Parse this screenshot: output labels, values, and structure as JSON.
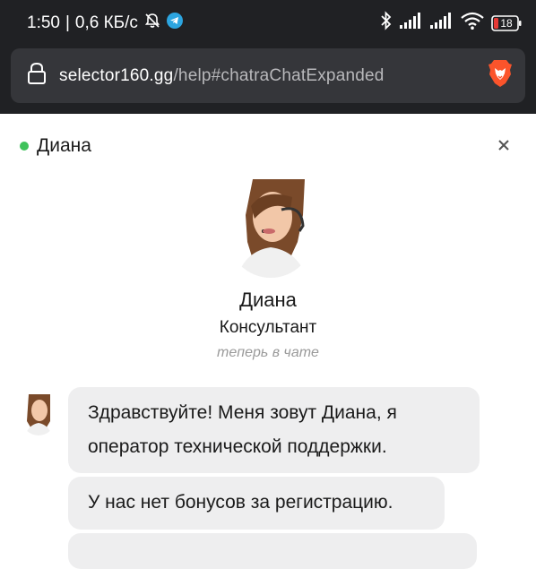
{
  "status_bar": {
    "time": "1:50",
    "speed": "0,6 КБ/с",
    "battery": "18",
    "icons": [
      "bell-off-icon",
      "telegram-icon",
      "bluetooth-icon",
      "signal-icon",
      "signal-icon",
      "wifi-icon",
      "battery-icon"
    ]
  },
  "browser": {
    "url_domain": "selector160.gg",
    "url_path": "/help#chatraChatExpanded"
  },
  "chat": {
    "header_name": "Диана",
    "agent": {
      "name": "Диана",
      "role": "Консультант",
      "status": "теперь в чате"
    },
    "messages": [
      {
        "text_line1": "Здравствуйте! Меня зовут Диана, я",
        "text_line2": "оператор технической поддержки."
      },
      {
        "text": "У нас нет бонусов за регистрацию."
      }
    ]
  },
  "colors": {
    "online": "#3fc25b",
    "bubble": "#eeeeef",
    "chrome_bg": "#202124",
    "brave": "#fb542b"
  }
}
